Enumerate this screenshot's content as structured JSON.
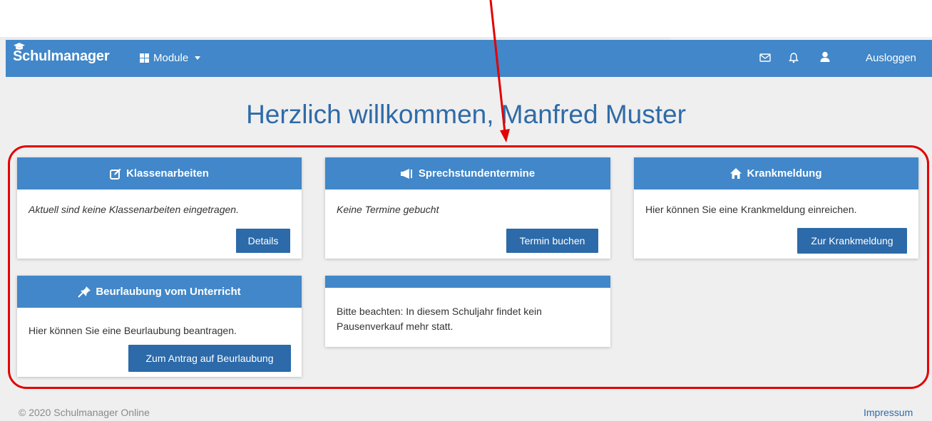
{
  "nav": {
    "brand": "Schulmanager",
    "modules_label": "Module",
    "logout_label": "Ausloggen"
  },
  "main": {
    "welcome_title": "Herzlich willkommen, Manfred Muster"
  },
  "cards": {
    "klassenarbeiten": {
      "title": "Klassenarbeiten",
      "text": "Aktuell sind keine Klassenarbeiten eingetragen.",
      "button": "Details"
    },
    "sprechstunden": {
      "title": "Sprechstundentermine",
      "text": "Keine Termine gebucht",
      "button": "Termin buchen"
    },
    "krankmeldung": {
      "title": "Krankmeldung",
      "text": "Hier können Sie eine Krankmeldung einreichen.",
      "button": "Zur Krankmeldung"
    },
    "beurlaubung": {
      "title": "Beurlaubung vom Unterricht",
      "text": "Hier können Sie eine Beurlaubung beantragen.",
      "button": "Zum Antrag auf Beurlaubung"
    },
    "hinweis": {
      "text": "Bitte beachten: In diesem Schuljahr findet kein Pausenverkauf mehr statt."
    }
  },
  "footer": {
    "copyright": "© 2020 Schulmanager Online",
    "impressum": "Impressum"
  },
  "colors": {
    "navbar": "#4187c9",
    "button": "#2c6aa9",
    "title": "#2f6ba7",
    "annotation": "#e20000"
  },
  "icons": [
    "graduation-cap-icon",
    "grid-icon",
    "caret-down-icon",
    "envelope-icon",
    "bell-icon",
    "user-icon",
    "edit-icon",
    "megaphone-icon",
    "home-icon",
    "pushpin-icon"
  ]
}
